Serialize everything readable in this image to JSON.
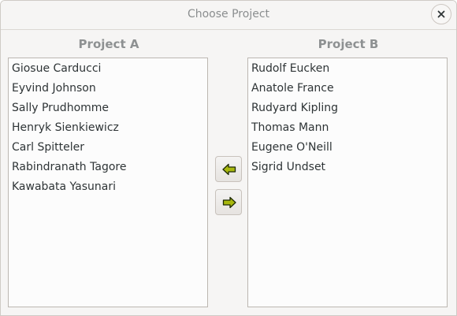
{
  "window": {
    "title": "Choose Project"
  },
  "project_a": {
    "header": "Project A",
    "items": [
      "Giosue Carducci",
      "Eyvind Johnson",
      "Sally Prudhomme",
      "Henryk Sienkiewicz",
      "Carl Spitteler",
      "Rabindranath Tagore",
      "Kawabata Yasunari"
    ]
  },
  "project_b": {
    "header": "Project B",
    "items": [
      "Rudolf Eucken",
      "Anatole France",
      "Rudyard Kipling",
      "Thomas Mann",
      "Eugene O'Neill",
      "Sigrid Undset"
    ]
  },
  "buttons": {
    "move_left_icon": "arrow-left-icon",
    "move_right_icon": "arrow-right-icon",
    "close_icon": "close-icon",
    "arrow_fill": "#a8b80e",
    "arrow_stroke": "#1e2a05"
  }
}
